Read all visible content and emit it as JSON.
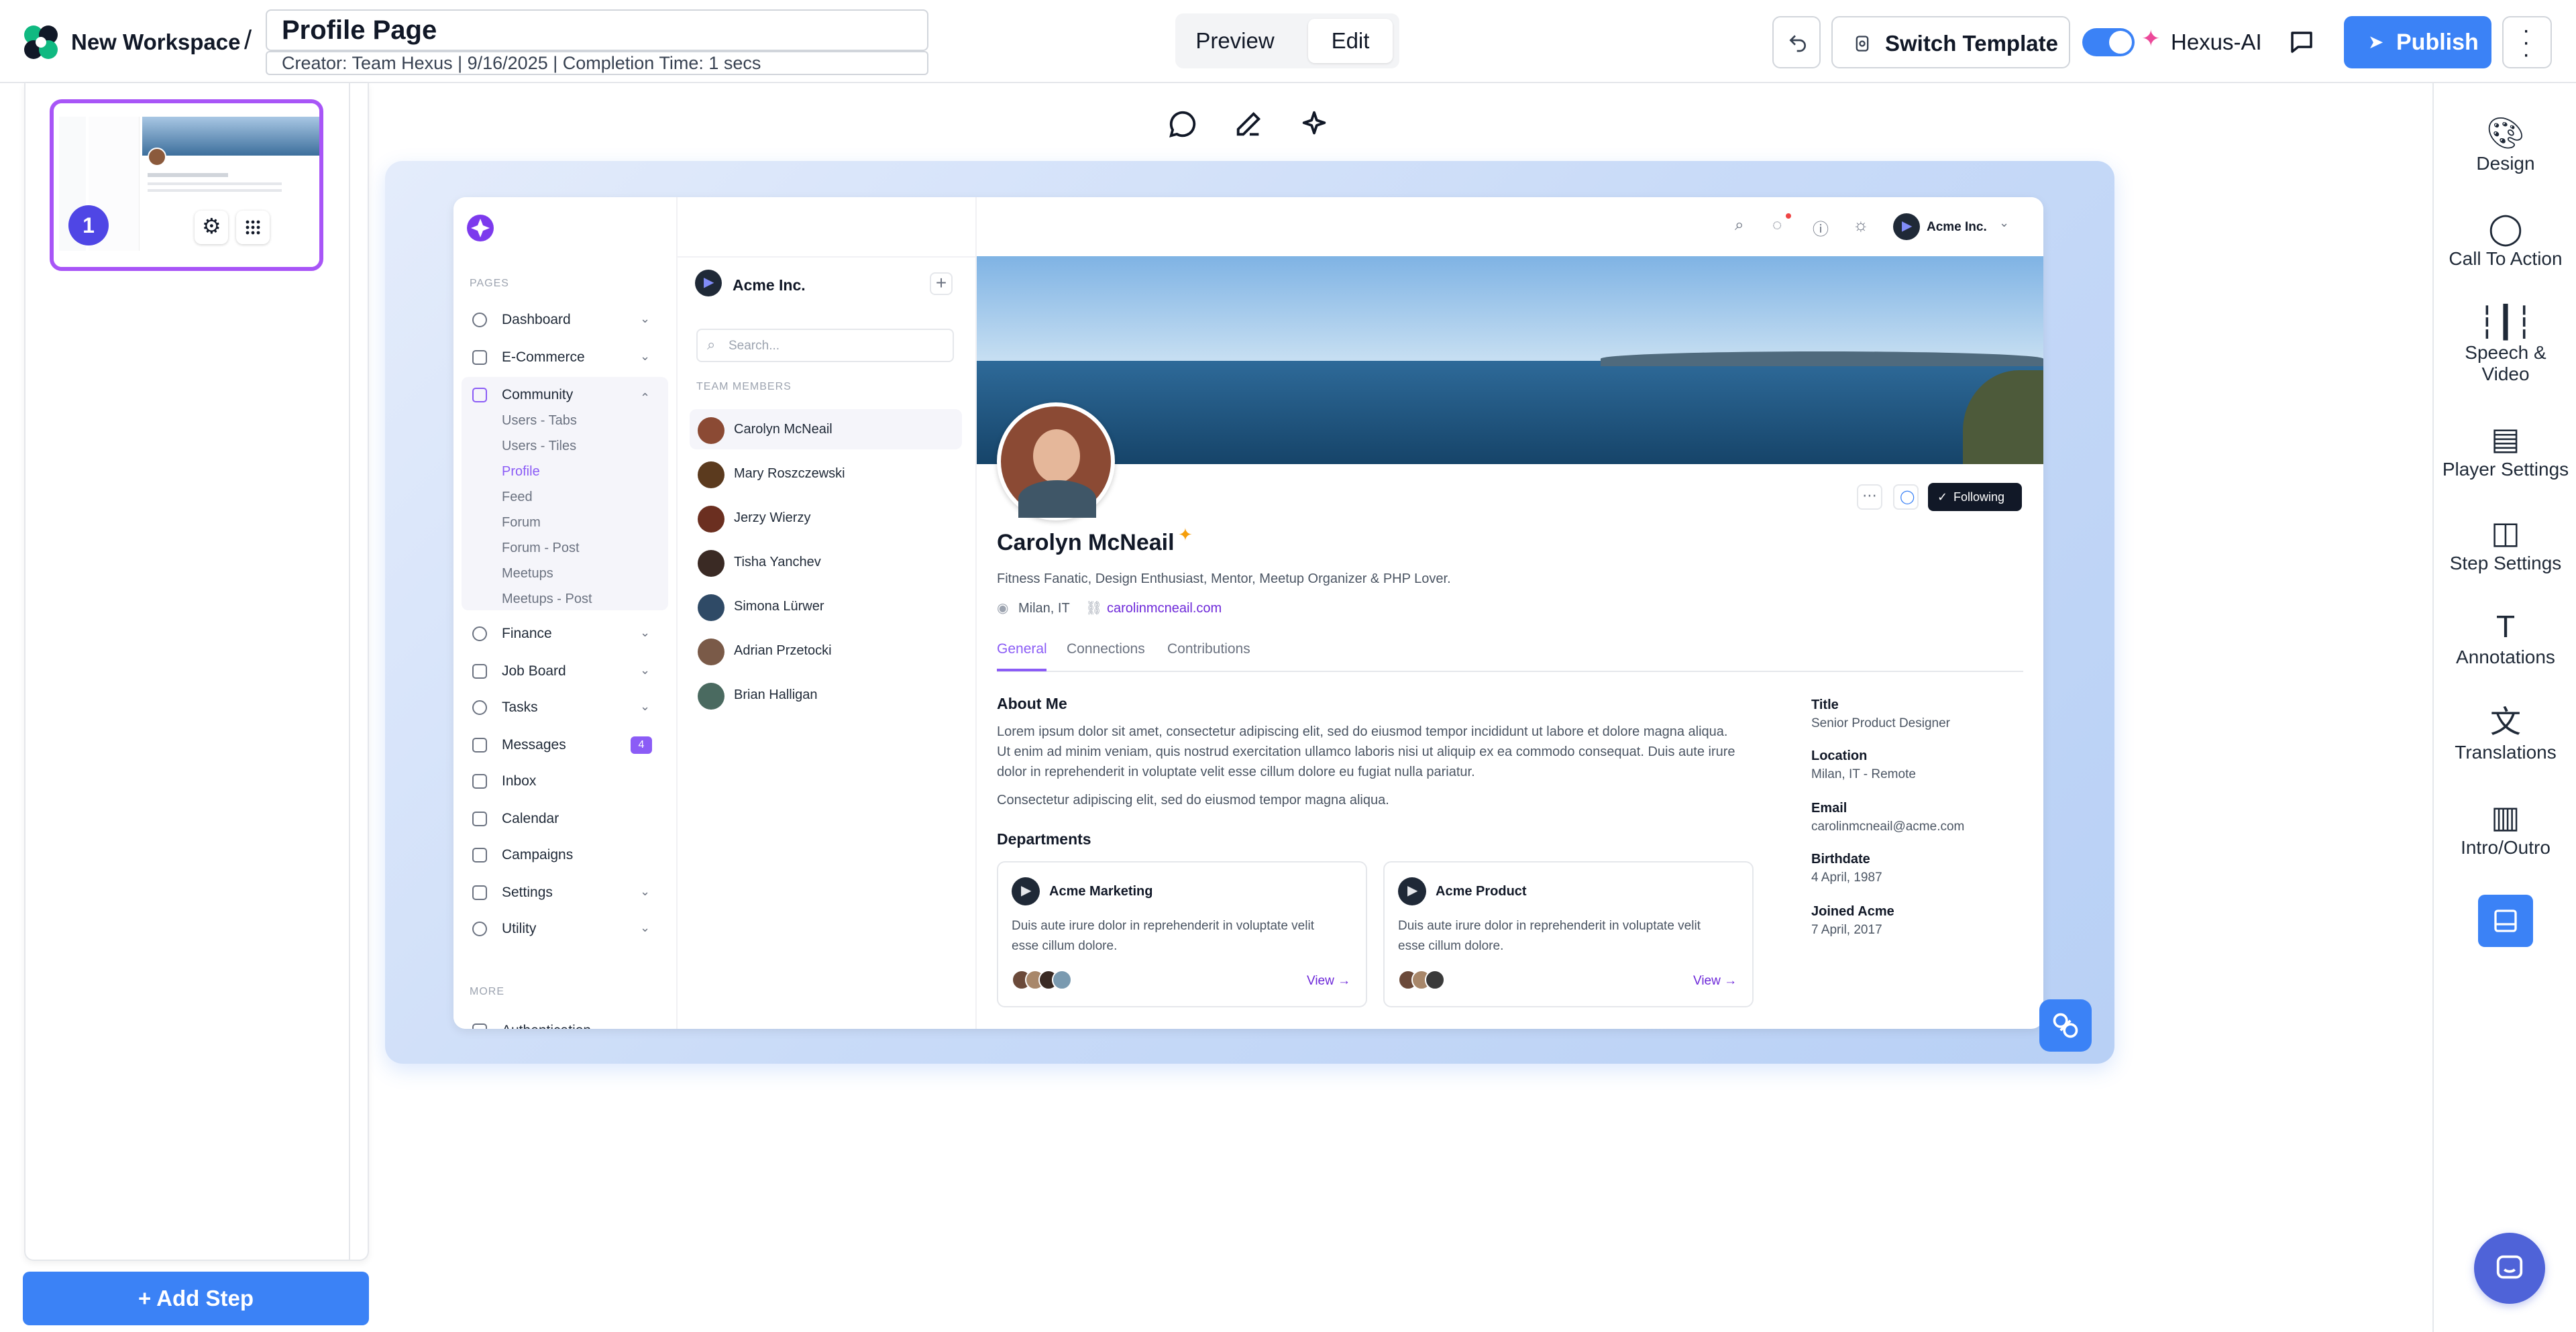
{
  "header": {
    "workspace": "New Workspace",
    "separator": "/",
    "title": "Profile Page",
    "subtitle": "Creator: Team Hexus | 9/16/2025 | Completion Time: 1 secs",
    "preview": "Preview",
    "edit": "Edit",
    "switch_template": "Switch Template",
    "hexus_ai": "Hexus-AI",
    "publish": "Publish"
  },
  "left": {
    "step_number": "1",
    "add_step": "+ Add Step"
  },
  "right_rail": [
    {
      "label": "Design",
      "icon": "palette-icon"
    },
    {
      "label": "Call To Action",
      "icon": "chat-bubble-icon"
    },
    {
      "label": "Speech &",
      "label2": "Video",
      "icon": "waveform-icon"
    },
    {
      "label": "Player Settings",
      "icon": "clapperboard-icon"
    },
    {
      "label": "Step Settings",
      "icon": "sidebar-panel-icon"
    },
    {
      "label": "Annotations",
      "icon": "text-t-icon"
    },
    {
      "label": "Translations",
      "icon": "translate-icon"
    },
    {
      "label": "Intro/Outro",
      "icon": "layout-icon"
    }
  ],
  "app": {
    "pages_label": "PAGES",
    "nav": [
      {
        "label": "Dashboard",
        "chev": "⌄"
      },
      {
        "label": "E-Commerce",
        "chev": "⌄"
      },
      {
        "label": "Community",
        "chev": "⌃"
      },
      {
        "label": "Finance",
        "chev": "⌄"
      },
      {
        "label": "Job Board",
        "chev": "⌄"
      },
      {
        "label": "Tasks",
        "chev": "⌄"
      },
      {
        "label": "Messages",
        "badge": "4"
      },
      {
        "label": "Inbox"
      },
      {
        "label": "Calendar"
      },
      {
        "label": "Campaigns"
      },
      {
        "label": "Settings",
        "chev": "⌄"
      },
      {
        "label": "Utility",
        "chev": "⌄"
      }
    ],
    "community_sub": [
      "Users - Tabs",
      "Users - Tiles",
      "Profile",
      "Feed",
      "Forum",
      "Forum - Post",
      "Meetups",
      "Meetups - Post"
    ],
    "more_label": "MORE",
    "auth_label": "Authentication",
    "company": "Acme Inc.",
    "search_placeholder": "Search...",
    "team_label": "TEAM MEMBERS",
    "members": [
      "Carolyn McNeail",
      "Mary Roszczewski",
      "Jerzy Wierzy",
      "Tisha Yanchev",
      "Simona Lürwer",
      "Adrian Przetocki",
      "Brian Halligan"
    ],
    "top_company": "Acme Inc.",
    "profile": {
      "name": "Carolyn McNeail",
      "bio": "Fitness Fanatic, Design Enthusiast, Mentor, Meetup Organizer & PHP Lover.",
      "location": "Milan, IT",
      "website": "carolinmcneail.com",
      "following": "Following",
      "tabs": [
        "General",
        "Connections",
        "Contributions"
      ],
      "about_title": "About Me",
      "about_p1": "Lorem ipsum dolor sit amet, consectetur adipiscing elit, sed do eiusmod tempor incididunt ut labore et dolore magna aliqua.",
      "about_p1b": "Ut enim ad minim veniam, quis nostrud exercitation ullamco laboris nisi ut aliquip ex ea commodo consequat. Duis aute irure",
      "about_p1c": "dolor in reprehenderit in voluptate velit esse cillum dolore eu fugiat nulla pariatur.",
      "about_p2": "Consectetur adipiscing elit, sed do eiusmod tempor magna aliqua.",
      "departments_title": "Departments",
      "departments": [
        {
          "name": "Acme Marketing",
          "desc1": "Duis aute irure dolor in reprehenderit in voluptate velit",
          "desc2": "esse cillum dolore.",
          "view": "View →"
        },
        {
          "name": "Acme Product",
          "desc1": "Duis aute irure dolor in reprehenderit in voluptate velit",
          "desc2": "esse cillum dolore.",
          "view": "View →"
        }
      ],
      "details": [
        {
          "label": "Title",
          "value": "Senior Product Designer"
        },
        {
          "label": "Location",
          "value": "Milan, IT - Remote"
        },
        {
          "label": "Email",
          "value": "carolinmcneail@acme.com"
        },
        {
          "label": "Birthdate",
          "value": "4 April, 1987"
        },
        {
          "label": "Joined Acme",
          "value": "7 April, 2017"
        }
      ]
    }
  },
  "colors": {
    "accent": "#3b82f6",
    "purple": "#8b5cf6",
    "thumb_border": "#a855f7"
  }
}
